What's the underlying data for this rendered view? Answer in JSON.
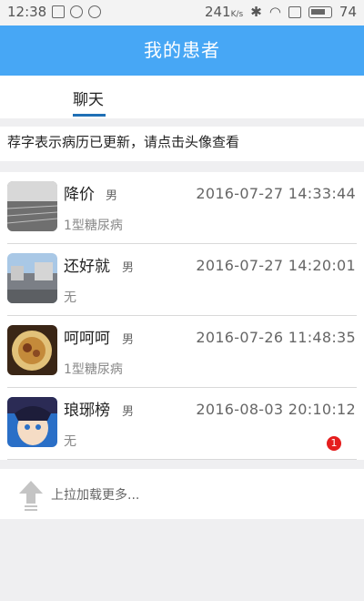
{
  "status_bar": {
    "time": "12:38",
    "net_speed": "241",
    "net_unit": "K/s",
    "battery": "74",
    "icons": [
      "image-icon",
      "check-circle-icon",
      "clock-icon",
      "bluetooth-icon",
      "wifi-icon",
      "square-icon",
      "battery-icon"
    ]
  },
  "header": {
    "title": "我的患者",
    "color": "#47a7f5"
  },
  "tabs": [
    {
      "label": "聊天",
      "active": true
    }
  ],
  "hint": "荐字表示病历已更新，请点击头像查看",
  "patients": [
    {
      "name": "降价",
      "gender": "男",
      "time": "2016-07-27  14:33:44",
      "diagnosis": "1型糖尿病",
      "unread": null
    },
    {
      "name": "还好就",
      "gender": "男",
      "time": "2016-07-27  14:20:01",
      "diagnosis": "无",
      "unread": null
    },
    {
      "name": "呵呵呵",
      "gender": "男",
      "time": "2016-07-26  11:48:35",
      "diagnosis": "1型糖尿病",
      "unread": null
    },
    {
      "name": "琅琊榜",
      "gender": "男",
      "time": "2016-08-03  20:10:12",
      "diagnosis": "无",
      "unread": "1"
    }
  ],
  "load_more": "上拉加载更多..."
}
